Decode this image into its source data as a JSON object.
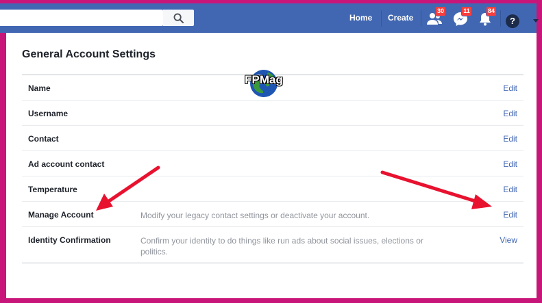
{
  "topbar": {
    "search_placeholder": "",
    "nav": {
      "home": "Home",
      "create": "Create"
    },
    "badges": {
      "friends": "30",
      "messages": "11",
      "notifications": "84"
    },
    "help": "?"
  },
  "page": {
    "title": "General Account Settings"
  },
  "settings": [
    {
      "label": "Name",
      "description": "",
      "action": "Edit"
    },
    {
      "label": "Username",
      "description": "",
      "action": "Edit"
    },
    {
      "label": "Contact",
      "description": "",
      "action": "Edit"
    },
    {
      "label": "Ad account contact",
      "description": "",
      "action": "Edit"
    },
    {
      "label": "Temperature",
      "description": "",
      "action": "Edit"
    },
    {
      "label": "Manage Account",
      "description": "Modify your legacy contact settings or deactivate your account.",
      "action": "Edit"
    },
    {
      "label": "Identity Confirmation",
      "description": "Confirm your identity to do things like run ads about social issues, elections or politics.",
      "action": "View"
    }
  ],
  "watermark": {
    "text": "FPMag"
  },
  "colors": {
    "topbar": "#4267b2",
    "frame": "#c8157a",
    "arrow": "#e8122f",
    "link": "#4267b2"
  }
}
